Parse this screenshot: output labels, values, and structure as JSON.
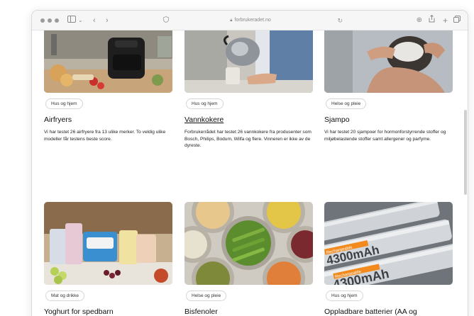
{
  "browser": {
    "url": "forbrukeradet.no"
  },
  "cards": [
    {
      "tag": "Hus og hjem",
      "title": "Airfryers",
      "description": "Vi har testet 26 airfryere fra 13 ulike merker. To veldig ulike modeller får testens beste score.",
      "image": "airfryer-photo"
    },
    {
      "tag": "Hus og hjem",
      "title": "Vannkokere",
      "description": "Forbrukerrådet har testet 26 vannkokere fra produsenter som Bosch, Philips, Bodum, Wilfa og flere. Vinneren er ikke av de dyreste.",
      "image": "kettle-photo"
    },
    {
      "tag": "Helse og pleie",
      "title": "Sjampo",
      "description": "Vi har testet 20 sjampoer for hormonforstyrrende stoffer og miljøbelastende stoffer samt allergener og parfyme.",
      "image": "shampoo-photo"
    },
    {
      "tag": "Mat og drikke",
      "title": "Yoghurt for spedbarn",
      "description": "",
      "image": "yoghurt-photo"
    },
    {
      "tag": "Helse og pleie",
      "title": "Bisfenoler",
      "description": "",
      "image": "canned-food-photo"
    },
    {
      "tag": "Hus og hjem",
      "title": "Oppladbare batterier (AA og",
      "description": "",
      "image": "batteries-photo"
    }
  ],
  "battery_print": {
    "brand": "Rechargeable",
    "capacity": "4300mAh"
  }
}
